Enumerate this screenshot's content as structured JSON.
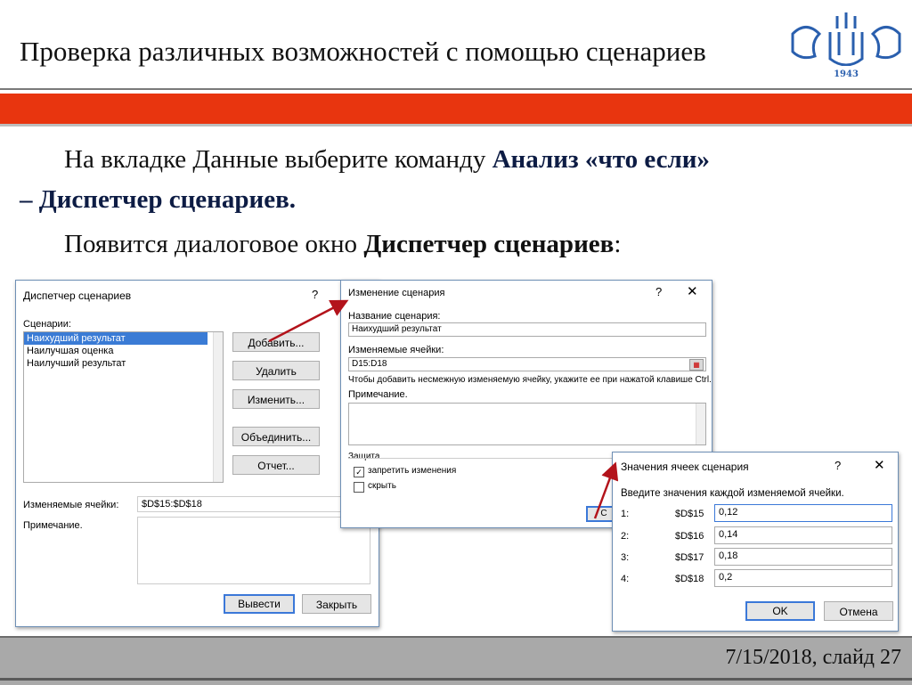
{
  "slide": {
    "title": "Проверка различных возможностей с помощью сценариев",
    "para1_a": "На вкладке Данные выберите команду ",
    "para1_b": "Анализ «что если»",
    "para1_c": "– Диспетчер сценариев.",
    "para2_a": "Появится диалоговое окно ",
    "para2_b": "Диспетчер сценариев",
    "para2_c": ":",
    "footer": "7/15/2018, слайд 27",
    "logo_year": "1943",
    "accent_color": "#e8350f"
  },
  "scenario_manager": {
    "title": "Диспетчер сценариев",
    "help": "?",
    "scenarios_label": "Сценарии:",
    "scenarios": [
      "Наихудший результат",
      "Наилучшая оценка",
      "Наилучший результат"
    ],
    "buttons": {
      "add": "Добавить...",
      "delete": "Удалить",
      "edit": "Изменить...",
      "merge": "Объединить...",
      "report": "Отчет..."
    },
    "changing_cells_label": "Изменяемые ячейки:",
    "changing_cells_value": "$D$15:$D$18",
    "comment_label": "Примечание.",
    "show": "Вывести",
    "close": "Закрыть"
  },
  "edit_scenario": {
    "title": "Изменение сценария",
    "help": "?",
    "close": "✕",
    "name_label": "Название сценария:",
    "name_value": "Наихудший результат",
    "cells_label": "Изменяемые ячейки:",
    "cells_value": "D15:D18",
    "hint": "Чтобы добавить несмежную изменяемую ячейку, укажите ее при нажатой клавише Ctrl.",
    "comment_label": "Примечание.",
    "protection_label": "Защита",
    "prevent_changes": "запретить изменения",
    "hide": "скрыть"
  },
  "scenario_values": {
    "title": "Значения ячеек сценария",
    "help": "?",
    "close": "✕",
    "prompt": "Введите значения каждой изменяемой ячейки.",
    "rows": [
      {
        "num": "1:",
        "cell": "$D$15",
        "value": "0,12"
      },
      {
        "num": "2:",
        "cell": "$D$16",
        "value": "0,14"
      },
      {
        "num": "3:",
        "cell": "$D$17",
        "value": "0,18"
      },
      {
        "num": "4:",
        "cell": "$D$18",
        "value": "0,2"
      }
    ],
    "ok": "OK",
    "cancel": "Отмена"
  }
}
